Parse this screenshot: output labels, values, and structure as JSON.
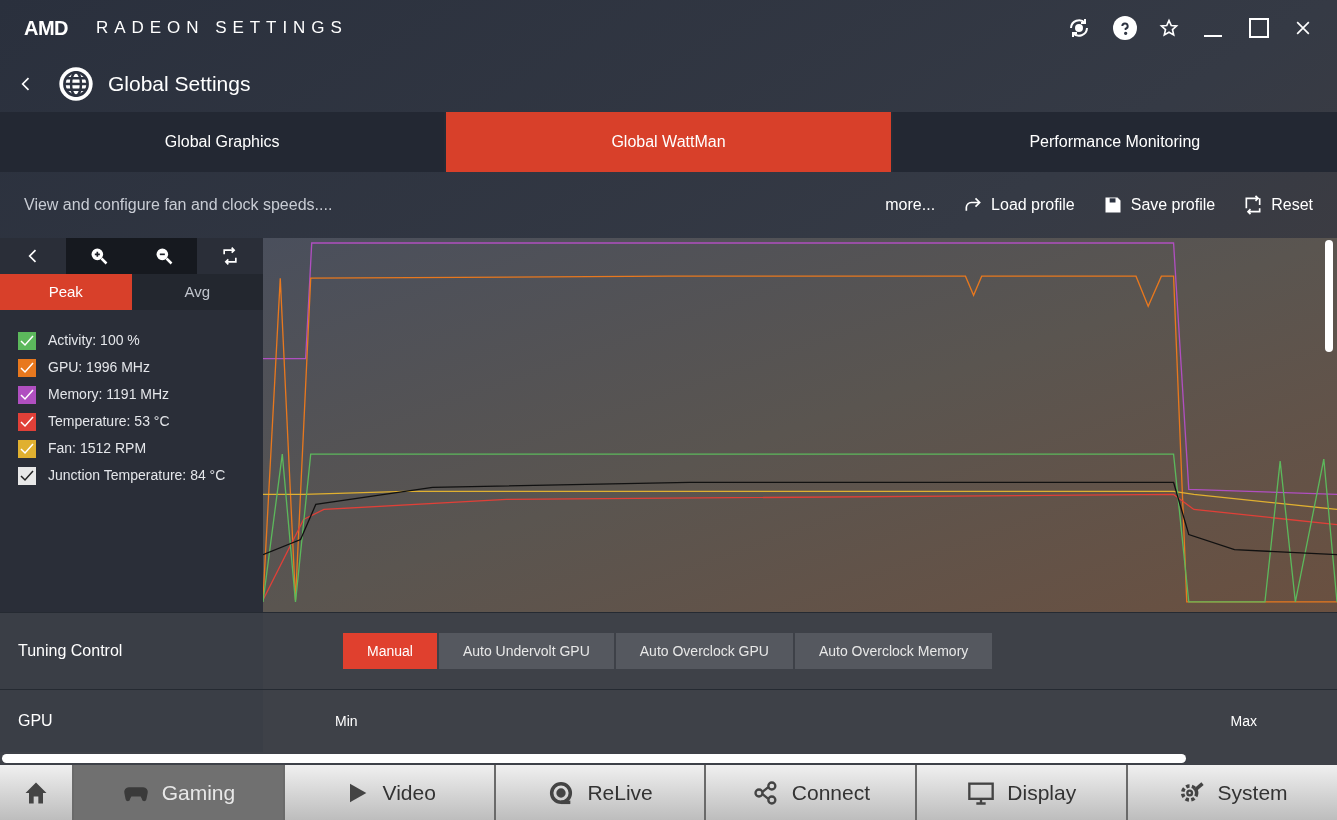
{
  "window": {
    "brand": "AMD",
    "title": "RADEON SETTINGS"
  },
  "header": {
    "title": "Global Settings"
  },
  "tabs": [
    {
      "label": "Global Graphics",
      "selected": false
    },
    {
      "label": "Global WattMan",
      "selected": true
    },
    {
      "label": "Performance Monitoring",
      "selected": false
    }
  ],
  "subheader": {
    "description": "View and configure fan and clock speeds....",
    "actions": [
      {
        "kind": "more",
        "label": "more..."
      },
      {
        "kind": "load",
        "label": "Load profile"
      },
      {
        "kind": "save",
        "label": "Save profile"
      },
      {
        "kind": "reset",
        "label": "Reset"
      }
    ]
  },
  "monitor": {
    "modes": [
      {
        "label": "Peak",
        "selected": true
      },
      {
        "label": "Avg",
        "selected": false
      }
    ],
    "legend": [
      {
        "label": "Activity: 100 %",
        "color": "#5cb85c",
        "checked": true
      },
      {
        "label": "GPU: 1996 MHz",
        "color": "#e8781e",
        "checked": true
      },
      {
        "label": "Memory: 1191 MHz",
        "color": "#b04fc0",
        "checked": true
      },
      {
        "label": "Temperature: 53 °C",
        "color": "#e04038",
        "checked": true
      },
      {
        "label": "Fan: 1512 RPM",
        "color": "#e0b030",
        "checked": true
      },
      {
        "label": "Junction Temperature: 84 °C",
        "color": "#e8e8e8",
        "checked": true
      }
    ]
  },
  "tuning_control": {
    "label": "Tuning Control",
    "options": [
      {
        "label": "Manual",
        "selected": true
      },
      {
        "label": "Auto Undervolt GPU",
        "selected": false
      },
      {
        "label": "Auto Overclock GPU",
        "selected": false
      },
      {
        "label": "Auto Overclock Memory",
        "selected": false
      }
    ]
  },
  "gpu": {
    "label": "GPU",
    "min": "Min",
    "max": "Max"
  },
  "bottom_nav": [
    {
      "kind": "home",
      "selected": false
    },
    {
      "kind": "gaming",
      "label": "Gaming",
      "selected": true
    },
    {
      "kind": "video",
      "label": "Video",
      "selected": false
    },
    {
      "kind": "relive",
      "label": "ReLive",
      "selected": false
    },
    {
      "kind": "connect",
      "label": "Connect",
      "selected": false
    },
    {
      "kind": "display",
      "label": "Display",
      "selected": false
    },
    {
      "kind": "system",
      "label": "System",
      "selected": false
    }
  ]
}
